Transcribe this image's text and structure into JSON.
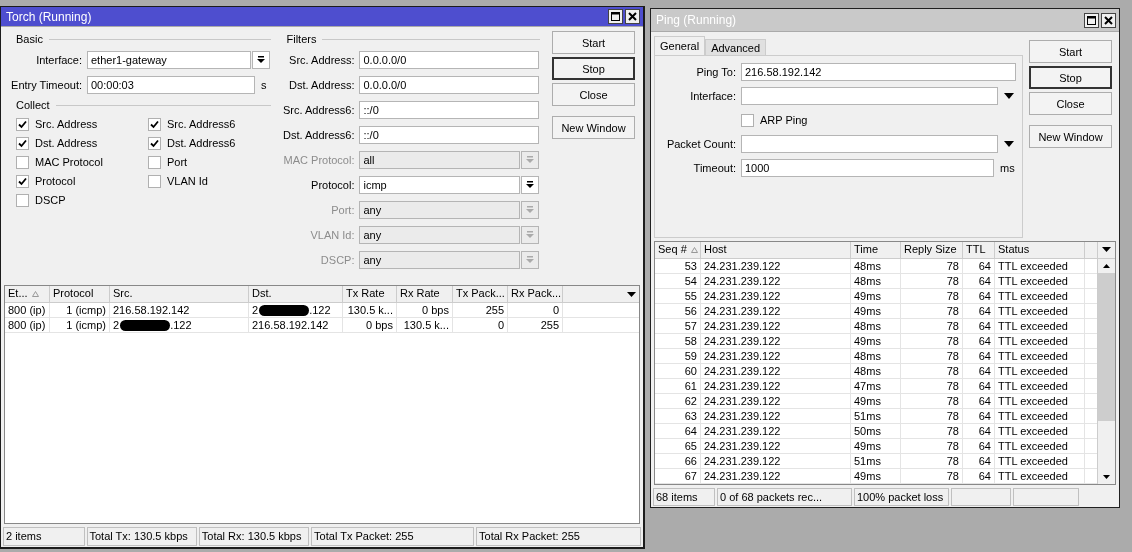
{
  "torch": {
    "title": "Torch (Running)",
    "active": true,
    "basic": {
      "title": "Basic",
      "interface": {
        "label": "Interface:",
        "value": "ether1-gateway"
      },
      "entry_timeout": {
        "label": "Entry Timeout:",
        "value": "00:00:03",
        "unit": "s"
      }
    },
    "collect": {
      "title": "Collect",
      "items": [
        {
          "label": "Src. Address",
          "checked": true
        },
        {
          "label": "Src. Address6",
          "checked": true
        },
        {
          "label": "Dst. Address",
          "checked": true
        },
        {
          "label": "Dst. Address6",
          "checked": true
        },
        {
          "label": "MAC Protocol",
          "checked": false
        },
        {
          "label": "Port",
          "checked": false
        },
        {
          "label": "Protocol",
          "checked": true
        },
        {
          "label": "VLAN Id",
          "checked": false
        },
        {
          "label": "DSCP",
          "checked": false
        }
      ]
    },
    "filters": {
      "title": "Filters",
      "fields": [
        {
          "kind": "text",
          "label": "Src. Address:",
          "value": "0.0.0.0/0",
          "disabled": false
        },
        {
          "kind": "text",
          "label": "Dst. Address:",
          "value": "0.0.0.0/0",
          "disabled": false
        },
        {
          "kind": "text",
          "label": "Src. Address6:",
          "value": "::/0",
          "disabled": false
        },
        {
          "kind": "text",
          "label": "Dst. Address6:",
          "value": "::/0",
          "disabled": false
        },
        {
          "kind": "select",
          "label": "MAC Protocol:",
          "value": "all",
          "disabled": true
        },
        {
          "kind": "select",
          "label": "Protocol:",
          "value": "icmp",
          "disabled": false
        },
        {
          "kind": "select",
          "label": "Port:",
          "value": "any",
          "disabled": true
        },
        {
          "kind": "select",
          "label": "VLAN Id:",
          "value": "any",
          "disabled": true
        },
        {
          "kind": "select",
          "label": "DSCP:",
          "value": "any",
          "disabled": true
        }
      ]
    },
    "buttons": [
      {
        "label": "Start",
        "focused": false
      },
      {
        "label": "Stop",
        "focused": true
      },
      {
        "label": "Close",
        "focused": false
      },
      {
        "label": "New Window",
        "focused": false
      }
    ],
    "table": {
      "columns": [
        "Et...",
        "Protocol",
        "Src.",
        "Dst.",
        "Tx Rate",
        "Rx Rate",
        "Tx Pack...",
        "Rx Pack..."
      ],
      "rows": [
        [
          "800 (ip)",
          "1 (icmp)",
          {
            "text": "216.58.192.142"
          },
          {
            "head": "2",
            "redacted": true,
            "tail": ".122"
          },
          "130.5 k...",
          "0 bps",
          "255",
          "0"
        ],
        [
          "800 (ip)",
          "1 (icmp)",
          {
            "head": "2",
            "redacted": true,
            "tail": ".122"
          },
          {
            "text": "216.58.192.142"
          },
          "0 bps",
          "130.5 k...",
          "0",
          "255"
        ]
      ]
    },
    "status_bar": [
      "2 items",
      "Total Tx: 130.5 kbps",
      "Total Rx: 130.5 kbps",
      "Total Tx Packet: 255",
      "Total Rx Packet: 255"
    ]
  },
  "ping": {
    "title": "Ping (Running)",
    "active": false,
    "tabs": [
      {
        "label": "General",
        "selected": true
      },
      {
        "label": "Advanced",
        "selected": false
      }
    ],
    "fields": [
      {
        "kind": "text",
        "label": "Ping To:",
        "value": "216.58.192.142"
      },
      {
        "kind": "select",
        "label": "Interface:"
      },
      {
        "kind": "checkbox",
        "label": "ARP Ping",
        "checked": false
      },
      {
        "kind": "select",
        "label": "Packet Count:"
      },
      {
        "kind": "text",
        "label": "Timeout:",
        "value": "1000",
        "unit": "ms"
      }
    ],
    "buttons": [
      {
        "label": "Start",
        "focused": false
      },
      {
        "label": "Stop",
        "focused": true
      },
      {
        "label": "Close",
        "focused": false
      },
      {
        "label": "New Window",
        "focused": false
      }
    ],
    "table": {
      "columns": [
        "Seq #",
        "Host",
        "Time",
        "Reply Size",
        "TTL",
        "Status"
      ],
      "rows": [
        [
          "53",
          "24.231.239.122",
          "48ms",
          "78",
          "64",
          "TTL exceeded"
        ],
        [
          "54",
          "24.231.239.122",
          "48ms",
          "78",
          "64",
          "TTL exceeded"
        ],
        [
          "55",
          "24.231.239.122",
          "49ms",
          "78",
          "64",
          "TTL exceeded"
        ],
        [
          "56",
          "24.231.239.122",
          "49ms",
          "78",
          "64",
          "TTL exceeded"
        ],
        [
          "57",
          "24.231.239.122",
          "48ms",
          "78",
          "64",
          "TTL exceeded"
        ],
        [
          "58",
          "24.231.239.122",
          "49ms",
          "78",
          "64",
          "TTL exceeded"
        ],
        [
          "59",
          "24.231.239.122",
          "48ms",
          "78",
          "64",
          "TTL exceeded"
        ],
        [
          "60",
          "24.231.239.122",
          "48ms",
          "78",
          "64",
          "TTL exceeded"
        ],
        [
          "61",
          "24.231.239.122",
          "47ms",
          "78",
          "64",
          "TTL exceeded"
        ],
        [
          "62",
          "24.231.239.122",
          "49ms",
          "78",
          "64",
          "TTL exceeded"
        ],
        [
          "63",
          "24.231.239.122",
          "51ms",
          "78",
          "64",
          "TTL exceeded"
        ],
        [
          "64",
          "24.231.239.122",
          "50ms",
          "78",
          "64",
          "TTL exceeded"
        ],
        [
          "65",
          "24.231.239.122",
          "49ms",
          "78",
          "64",
          "TTL exceeded"
        ],
        [
          "66",
          "24.231.239.122",
          "51ms",
          "78",
          "64",
          "TTL exceeded"
        ],
        [
          "67",
          "24.231.239.122",
          "49ms",
          "78",
          "64",
          "TTL exceeded"
        ]
      ]
    },
    "status_bar": [
      "68 items",
      "0 of 68 packets rec...",
      "100% packet loss"
    ]
  }
}
